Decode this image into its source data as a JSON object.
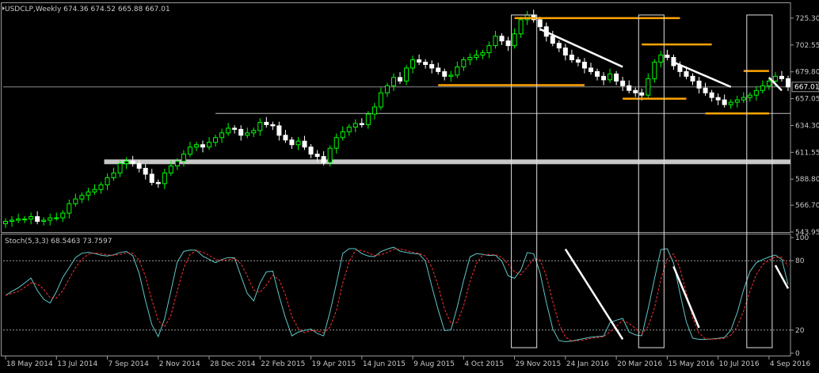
{
  "chart_data": [
    {
      "type": "candlestick",
      "title": "USDCLP,Weekly  674.36 674.52 665.88 667.01",
      "symbol": "USDCLP",
      "timeframe": "Weekly",
      "ohlc_last": {
        "open": 674.36,
        "high": 674.52,
        "low": 665.88,
        "close": 667.01
      },
      "current_price_label": "667.01",
      "y_ticks": [
        "725.30",
        "702.55",
        "679.80",
        "657.05",
        "634.30",
        "611.55",
        "588.80",
        "566.70",
        "543.95"
      ],
      "ylim": [
        543.95,
        736
      ],
      "x_ticks": [
        "18 May 2014",
        "13 Jul 2014",
        "7 Sep 2014",
        "2 Nov 2014",
        "28 Dec 2014",
        "22 Feb 2015",
        "19 Apr 2015",
        "14 Jun 2015",
        "9 Aug 2015",
        "4 Oct 2015",
        "29 Nov 2015",
        "24 Jan 2016",
        "20 Mar 2016",
        "15 May 2016",
        "10 Jul 2016",
        "4 Sep 2016"
      ],
      "x_tick_weeks": [
        0,
        8,
        16,
        24,
        32,
        40,
        48,
        56,
        64,
        72,
        80,
        88,
        96,
        104,
        112,
        120
      ],
      "close": [
        553,
        554,
        555,
        555,
        557,
        553,
        554,
        556,
        556,
        560,
        568,
        572,
        575,
        578,
        580,
        584,
        590,
        594,
        602,
        604,
        602,
        598,
        593,
        586,
        585,
        594,
        600,
        604,
        610,
        616,
        618,
        616,
        620,
        624,
        628,
        632,
        631,
        626,
        628,
        630,
        637,
        635,
        634,
        626,
        622,
        618,
        621,
        616,
        610,
        608,
        603,
        615,
        624,
        629,
        633,
        636,
        635,
        644,
        650,
        662,
        668,
        675,
        672,
        683,
        690,
        688,
        686,
        683,
        680,
        676,
        677,
        684,
        690,
        692,
        694,
        696,
        702,
        710,
        706,
        702,
        712,
        724,
        728,
        724,
        718,
        710,
        704,
        700,
        694,
        690,
        688,
        683,
        680,
        676,
        673,
        678,
        672,
        668,
        664,
        662,
        660,
        674,
        688,
        694,
        692,
        685,
        680,
        676,
        672,
        666,
        662,
        658,
        656,
        652,
        654,
        656,
        658,
        660,
        664,
        668,
        672,
        676,
        674,
        667
      ],
      "stochastic": {
        "label": "Stoch(5,3,3) 68.5463 73.7597",
        "main_value": 68.5463,
        "signal_value": 73.7597,
        "levels": [
          20,
          80
        ],
        "y_ticks": [
          "100",
          "80",
          "20",
          "0"
        ],
        "main_color": "#5fc7c7",
        "signal_color": "#ff3030"
      },
      "support_resistance_levels": [
        {
          "value": 725.3,
          "from_week": 80,
          "to_week": 106,
          "color": "#ffa500"
        },
        {
          "value": 668.5,
          "from_week": 68,
          "to_week": 91,
          "color": "#ffa500"
        },
        {
          "value": 703,
          "from_week": 100,
          "to_week": 111,
          "color": "#ffa500"
        },
        {
          "value": 657.05,
          "from_week": 97,
          "to_week": 107,
          "color": "#ffa500"
        },
        {
          "value": 680.5,
          "from_week": 116,
          "to_week": 120,
          "color": "#ffa500"
        },
        {
          "value": 644.5,
          "from_week": 110,
          "to_week": 120,
          "color": "#ffa500"
        }
      ],
      "horizontal_line": {
        "value": 644.5,
        "from_week": 33
      },
      "gray_zone": [
        601.5,
        605.5
      ],
      "colors": {
        "bull": "#00ff00",
        "bear": "#ffffff",
        "grid": "#7a7a7a",
        "axis_text": "#c8c8c8",
        "annotation": "#ffa500",
        "background": "#000000"
      }
    }
  ]
}
